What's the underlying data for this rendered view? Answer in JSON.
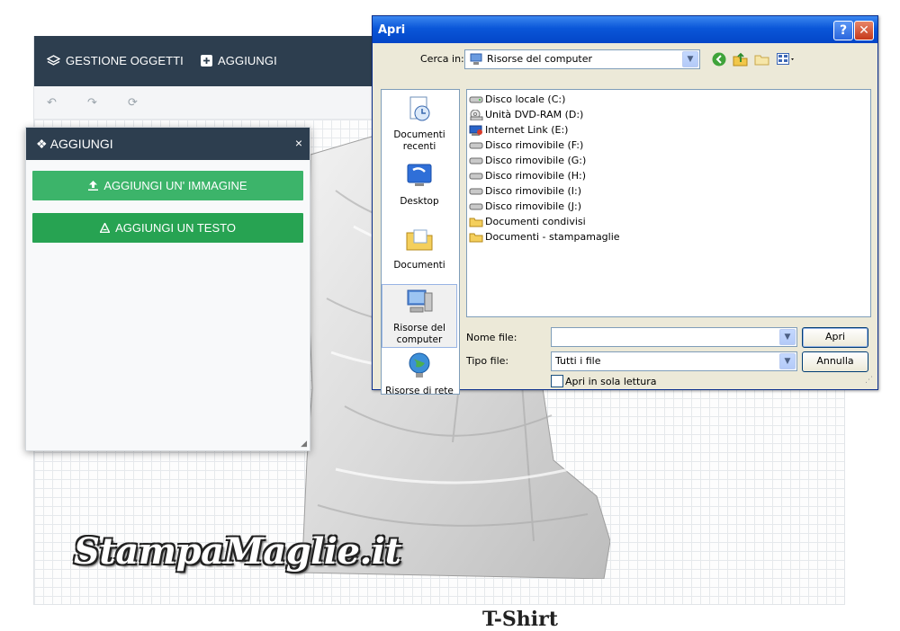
{
  "editor": {
    "nav": {
      "manage_label": "GESTIONE OGGETTI",
      "add_label": "AGGIUNGI"
    },
    "icons": [
      "layers-icon",
      "plus-square-icon",
      "undo-icon",
      "redo-icon",
      "refresh-icon"
    ],
    "logo_text": "StampaMaglie.it",
    "product_label": "T-Shirt"
  },
  "panel": {
    "title": "AGGIUNGI",
    "close_label": "×",
    "add_image_label": "AGGIUNGI UN' IMMAGINE",
    "add_text_label": "AGGIUNGI UN TESTO",
    "colors": {
      "header": "#2d3e4f",
      "btn_image": "#3cb46a",
      "btn_text": "#27a352"
    }
  },
  "dialog": {
    "title": "Apri",
    "help_label": "?",
    "close_label": "✕",
    "look_in_label": "Cerca in:",
    "look_in_value": "Risorse del computer",
    "places": [
      {
        "label": "Documenti recenti",
        "icon": "recent-documents-icon"
      },
      {
        "label": "Desktop",
        "icon": "desktop-icon"
      },
      {
        "label": "Documenti",
        "icon": "my-documents-icon"
      },
      {
        "label": "Risorse del computer",
        "icon": "my-computer-icon"
      },
      {
        "label": "Risorse di rete",
        "icon": "network-icon"
      }
    ],
    "files": [
      {
        "label": "Disco locale (C:)",
        "icon": "hard-drive-icon"
      },
      {
        "label": "Unità DVD-RAM (D:)",
        "icon": "dvd-drive-icon"
      },
      {
        "label": "Internet Link (E:)",
        "icon": "network-drive-icon"
      },
      {
        "label": "Disco rimovibile (F:)",
        "icon": "removable-drive-icon"
      },
      {
        "label": "Disco rimovibile (G:)",
        "icon": "removable-drive-icon"
      },
      {
        "label": "Disco rimovibile (H:)",
        "icon": "removable-drive-icon"
      },
      {
        "label": "Disco rimovibile (I:)",
        "icon": "removable-drive-icon"
      },
      {
        "label": "Disco rimovibile (J:)",
        "icon": "removable-drive-icon"
      },
      {
        "label": "Documenti condivisi",
        "icon": "folder-icon"
      },
      {
        "label": "Documenti - stampamaglie",
        "icon": "folder-icon"
      }
    ],
    "filename_label": "Nome file:",
    "filename_value": "",
    "filetype_label": "Tipo file:",
    "filetype_value": "Tutti i file",
    "readonly_label": "Apri in sola lettura",
    "open_button": "Apri",
    "cancel_button": "Annulla"
  }
}
